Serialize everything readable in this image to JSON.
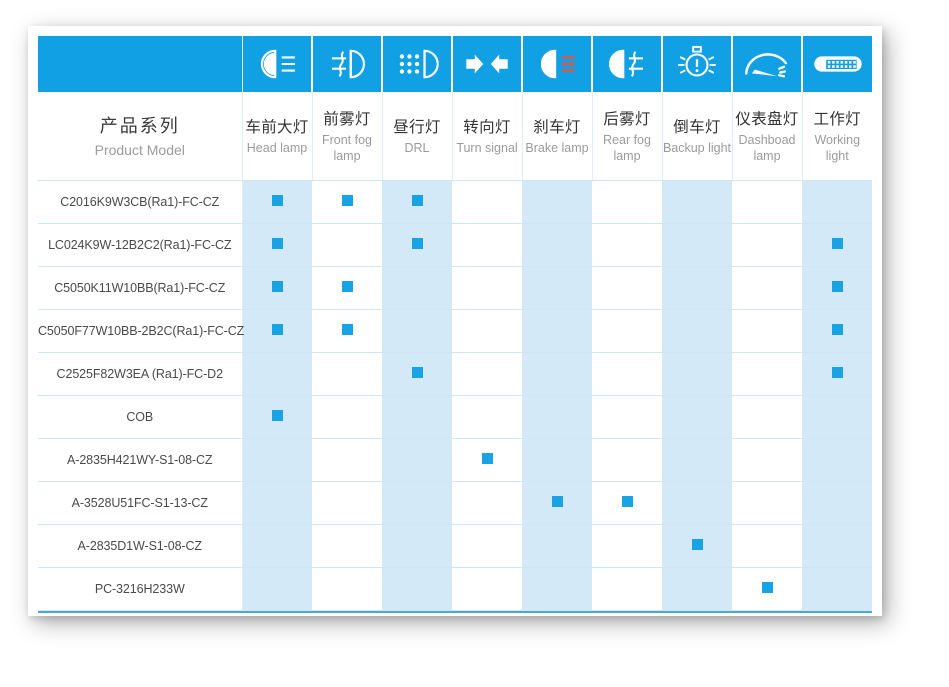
{
  "theme": {
    "header_blue": "#12A0E4",
    "marker_blue": "#17A3E4",
    "shade_blue": "#D4E9F7",
    "grid_line": "#CFE7F5",
    "bottom_rule": "#4BA9CF"
  },
  "table": {
    "model_column": {
      "title_cn": "产品系列",
      "title_en": "Product Model"
    },
    "columns": [
      {
        "icon": "head-lamp-icon",
        "cn": "车前大灯",
        "en": "Head lamp",
        "shaded": true
      },
      {
        "icon": "front-fog-lamp-icon",
        "cn": "前雾灯",
        "en": "Front fog lamp",
        "shaded": false
      },
      {
        "icon": "drl-icon",
        "cn": "昼行灯",
        "en": "DRL",
        "shaded": true
      },
      {
        "icon": "turn-signal-icon",
        "cn": "转向灯",
        "en": "Turn signal",
        "shaded": false
      },
      {
        "icon": "brake-lamp-icon",
        "cn": "刹车灯",
        "en": "Brake lamp",
        "shaded": true
      },
      {
        "icon": "rear-fog-lamp-icon",
        "cn": "后雾灯",
        "en": "Rear fog lamp",
        "shaded": false
      },
      {
        "icon": "backup-light-icon",
        "cn": "倒车灯",
        "en": "Backup light",
        "shaded": true
      },
      {
        "icon": "dashboard-lamp-icon",
        "cn": "仪表盘灯",
        "en": "Dashboad lamp",
        "shaded": false
      },
      {
        "icon": "working-light-icon",
        "cn": "工作灯",
        "en": "Working light",
        "shaded": true
      }
    ],
    "rows": [
      {
        "model": "C2016K9W3CB(Ra1)-FC-CZ",
        "marks": [
          1,
          1,
          1,
          0,
          0,
          0,
          0,
          0,
          0
        ]
      },
      {
        "model": "LC024K9W-12B2C2(Ra1)-FC-CZ",
        "marks": [
          1,
          0,
          1,
          0,
          0,
          0,
          0,
          0,
          1
        ]
      },
      {
        "model": "C5050K11W10BB(Ra1)-FC-CZ",
        "marks": [
          1,
          1,
          0,
          0,
          0,
          0,
          0,
          0,
          1
        ]
      },
      {
        "model": "C5050F77W10BB-2B2C(Ra1)-FC-CZ",
        "marks": [
          1,
          1,
          0,
          0,
          0,
          0,
          0,
          0,
          1
        ]
      },
      {
        "model": "C2525F82W3EA (Ra1)-FC-D2",
        "marks": [
          0,
          0,
          1,
          0,
          0,
          0,
          0,
          0,
          1
        ]
      },
      {
        "model": "COB",
        "marks": [
          1,
          0,
          0,
          0,
          0,
          0,
          0,
          0,
          0
        ]
      },
      {
        "model": "A-2835H421WY-S1-08-CZ",
        "marks": [
          0,
          0,
          0,
          1,
          0,
          0,
          0,
          0,
          0
        ]
      },
      {
        "model": "A-3528U51FC-S1-13-CZ",
        "marks": [
          0,
          0,
          0,
          0,
          1,
          1,
          0,
          0,
          0
        ]
      },
      {
        "model": "A-2835D1W-S1-08-CZ",
        "marks": [
          0,
          0,
          0,
          0,
          0,
          0,
          1,
          0,
          0
        ]
      },
      {
        "model": "PC-3216H233W",
        "marks": [
          0,
          0,
          0,
          0,
          0,
          0,
          0,
          1,
          0
        ]
      }
    ]
  }
}
